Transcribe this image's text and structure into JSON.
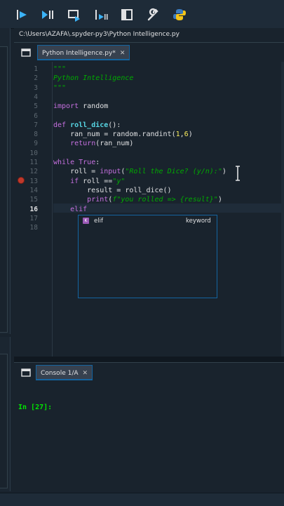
{
  "toolbar": {
    "buttons": [
      {
        "name": "run-icon"
      },
      {
        "name": "run-cell-icon"
      },
      {
        "name": "run-cell-advance-icon"
      },
      {
        "name": "run-selection-icon"
      },
      {
        "name": "maximize-pane-icon"
      },
      {
        "name": "preferences-wrench-icon"
      },
      {
        "name": "python-path-icon"
      }
    ]
  },
  "editor": {
    "path": "C:\\Users\\AZAFA\\.spyder-py3\\Python Intelligence.py",
    "tab_label": "Python Intelligence.py*",
    "tab_close": "✕",
    "active_line": "16",
    "breakpoint_line": "13",
    "line_numbers": [
      "1",
      "2",
      "3",
      "4",
      "5",
      "6",
      "7",
      "8",
      "9",
      "10",
      "11",
      "12",
      "13",
      "14",
      "15",
      "16",
      "17",
      "18"
    ],
    "code": {
      "l1": "\"\"\"",
      "l2": "Python Intelligence",
      "l3": "\"\"\"",
      "l5_kw": "import",
      "l5_rest": " random",
      "l7_kw": "def",
      "l7_fn": "roll_dice",
      "l7_rest": "():",
      "l8_a": "    ran_num = random.randint(",
      "l8_n1": "1",
      "l8_c": ",",
      "l8_n2": "6",
      "l8_e": ")",
      "l9_kw": "return",
      "l9_rest": "(ran_num)",
      "l11_kw": "while",
      "l11_sp": " ",
      "l11_true": "True",
      "l11_rest": ":",
      "l12_a": "    roll = ",
      "l12_bi": "input",
      "l12_p": "(",
      "l12_str": "\"Roll the Dice? (y/n):\"",
      "l12_e": ")",
      "l13_kw": "if",
      "l13_a": " roll ==",
      "l13_str": "\"y\"",
      "l14": "        result = roll_dice()",
      "l15_bi": "print",
      "l15_p": "(",
      "l15_str": "f\"you rolled => {result}\"",
      "l15_e": ")",
      "l16_kw": "elif"
    },
    "completion": {
      "badge": "K",
      "item": "elif",
      "kind": "keyword"
    }
  },
  "console": {
    "tab_label": "Console 1/A",
    "tab_close": "✕",
    "prompt": "In [27]:"
  },
  "colors": {
    "background": "#19232d",
    "accent": "#1464a0",
    "docstring": "#00aa00",
    "keyword": "#c670e0",
    "number": "#faed5c",
    "prompt": "#00e600"
  }
}
